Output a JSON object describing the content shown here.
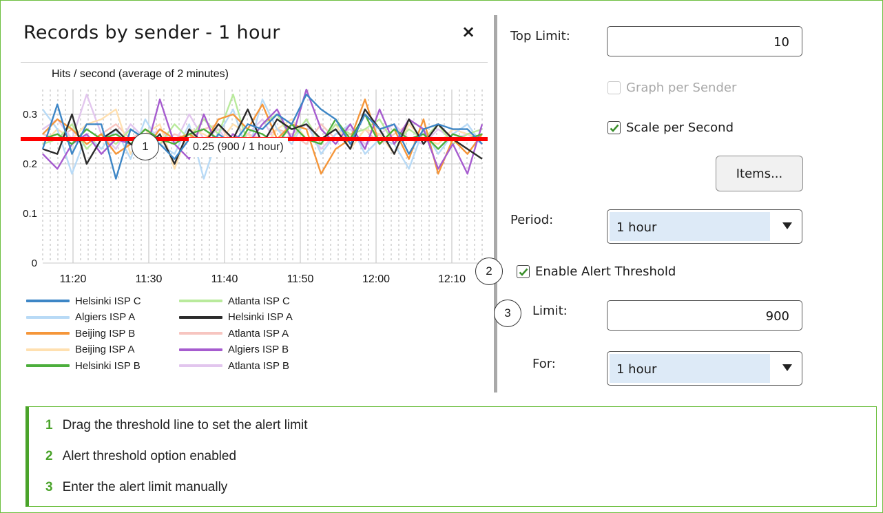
{
  "window": {
    "title": "Records by sender - 1 hour",
    "close_glyph": "×"
  },
  "chart_data": {
    "type": "line",
    "title": "Hits / second (average of 2 minutes)",
    "ylim": [
      0,
      0.35
    ],
    "y_ticks": [
      "0.3",
      "0.2",
      "0.1",
      "0"
    ],
    "x_ticks": [
      "11:20",
      "11:30",
      "11:40",
      "11:50",
      "12:00",
      "12:10"
    ],
    "x_tick_minutes": [
      20,
      30,
      40,
      50,
      60,
      70
    ],
    "x_range_minutes": [
      16,
      74
    ],
    "grid": true,
    "threshold": {
      "value": 0.25,
      "label": "0.25 (900 / 1 hour)",
      "color": "#ff0000"
    },
    "series": [
      {
        "name": "Helsinki ISP C",
        "color": "#3d86c6",
        "values": [
          0.23,
          0.32,
          0.22,
          0.28,
          0.28,
          0.17,
          0.27,
          0.25,
          0.24,
          0.21,
          0.25,
          0.22,
          0.26,
          0.24,
          0.28,
          0.27,
          0.3,
          0.28,
          0.34,
          0.31,
          0.29,
          0.24,
          0.3,
          0.27,
          0.28,
          0.22,
          0.27,
          0.28,
          0.27,
          0.27,
          0.24
        ]
      },
      {
        "name": "Algiers ISP A",
        "color": "#b8daf6",
        "values": [
          0.31,
          0.27,
          0.18,
          0.26,
          0.23,
          0.27,
          0.21,
          0.29,
          0.24,
          0.22,
          0.28,
          0.17,
          0.26,
          0.31,
          0.22,
          0.33,
          0.27,
          0.24,
          0.29,
          0.22,
          0.26,
          0.28,
          0.22,
          0.25,
          0.24,
          0.19,
          0.27,
          0.22,
          0.26,
          0.28,
          0.24
        ]
      },
      {
        "name": "Beijing ISP B",
        "color": "#f5963a",
        "values": [
          0.26,
          0.29,
          0.27,
          0.24,
          0.26,
          0.22,
          0.24,
          0.23,
          0.27,
          0.25,
          0.26,
          0.24,
          0.29,
          0.3,
          0.27,
          0.32,
          0.25,
          0.28,
          0.27,
          0.18,
          0.23,
          0.25,
          0.33,
          0.24,
          0.27,
          0.21,
          0.29,
          0.18,
          0.25,
          0.22,
          0.26
        ]
      },
      {
        "name": "Beijing ISP A",
        "color": "#ffe0b0",
        "values": [
          0.24,
          0.27,
          0.25,
          0.28,
          0.29,
          0.31,
          0.22,
          0.26,
          0.28,
          0.19,
          0.27,
          0.26,
          0.24,
          0.28,
          0.26,
          0.23,
          0.27,
          0.29,
          0.25,
          0.24,
          0.28,
          0.23,
          0.27,
          0.26,
          0.22,
          0.28,
          0.25,
          0.24,
          0.27,
          0.26,
          0.25
        ]
      },
      {
        "name": "Helsinki ISP B",
        "color": "#4cae3c",
        "values": [
          0.25,
          0.26,
          0.24,
          0.27,
          0.25,
          0.26,
          0.24,
          0.27,
          0.25,
          0.24,
          0.26,
          0.27,
          0.25,
          0.22,
          0.27,
          0.26,
          0.24,
          0.28,
          0.25,
          0.24,
          0.29,
          0.25,
          0.3,
          0.24,
          0.27,
          0.25,
          0.26,
          0.23,
          0.26,
          0.25,
          0.26
        ]
      },
      {
        "name": "Atlanta ISP C",
        "color": "#b9ea9c",
        "values": [
          0.24,
          0.25,
          0.28,
          0.23,
          0.26,
          0.24,
          0.27,
          0.25,
          0.24,
          0.28,
          0.25,
          0.29,
          0.26,
          0.34,
          0.24,
          0.28,
          0.3,
          0.25,
          0.29,
          0.24,
          0.28,
          0.26,
          0.27,
          0.29,
          0.24,
          0.27,
          0.25,
          0.28,
          0.24,
          0.26,
          0.27
        ]
      },
      {
        "name": "Helsinki ISP A",
        "color": "#2b2b2b",
        "values": [
          0.23,
          0.22,
          0.3,
          0.2,
          0.25,
          0.27,
          0.24,
          0.23,
          0.26,
          0.2,
          0.27,
          0.24,
          0.28,
          0.25,
          0.31,
          0.24,
          0.29,
          0.27,
          0.28,
          0.25,
          0.27,
          0.23,
          0.31,
          0.27,
          0.22,
          0.29,
          0.24,
          0.28,
          0.25,
          0.23,
          0.21
        ]
      },
      {
        "name": "Atlanta ISP A",
        "color": "#f7c5c0",
        "values": [
          0.26,
          0.25,
          0.27,
          0.24,
          0.26,
          0.28,
          0.25,
          0.27,
          0.24,
          0.26,
          0.25,
          0.27,
          0.28,
          0.24,
          0.26,
          0.25,
          0.27,
          0.26,
          0.24,
          0.28,
          0.25,
          0.26,
          0.27,
          0.24,
          0.26,
          0.28,
          0.25,
          0.24,
          0.27,
          0.26,
          0.25
        ]
      },
      {
        "name": "Algiers ISP B",
        "color": "#a65ccf",
        "values": [
          0.22,
          0.19,
          0.24,
          0.26,
          0.22,
          0.25,
          0.24,
          0.22,
          0.33,
          0.24,
          0.21,
          0.3,
          0.23,
          0.26,
          0.24,
          0.28,
          0.31,
          0.25,
          0.35,
          0.27,
          0.24,
          0.28,
          0.23,
          0.31,
          0.24,
          0.29,
          0.27,
          0.19,
          0.24,
          0.18,
          0.28
        ]
      },
      {
        "name": "Atlanta ISP B",
        "color": "#e2c6ee",
        "values": [
          0.27,
          0.29,
          0.25,
          0.34,
          0.26,
          0.23,
          0.28,
          0.25,
          0.27,
          0.24,
          0.3,
          0.25,
          0.27,
          0.23,
          0.26,
          0.29,
          0.24,
          0.26,
          0.28,
          0.23,
          0.26,
          0.27,
          0.24,
          0.26,
          0.28,
          0.25,
          0.24,
          0.27,
          0.25,
          0.26,
          0.24
        ]
      }
    ]
  },
  "callouts": {
    "one": "1",
    "two": "2",
    "three": "3"
  },
  "settings": {
    "top_limit_label": "Top Limit:",
    "top_limit_value": "10",
    "graph_per_sender_label": "Graph per Sender",
    "graph_per_sender_checked": false,
    "scale_per_second_label": "Scale per Second",
    "scale_per_second_checked": true,
    "items_button": "Items...",
    "period_label": "Period:",
    "period_value": "1 hour",
    "enable_alert_label": "Enable Alert Threshold",
    "enable_alert_checked": true,
    "limit_label": "Limit:",
    "limit_value": "900",
    "for_label": "For:",
    "for_value": "1 hour"
  },
  "notes": [
    {
      "num": "1",
      "text": "Drag the threshold line to set the alert limit"
    },
    {
      "num": "2",
      "text": "Alert threshold option enabled"
    },
    {
      "num": "3",
      "text": "Enter the alert limit manually"
    }
  ],
  "icons": {
    "close": "close-icon",
    "check": "checkmark-icon",
    "dropdown": "chevron-down-icon"
  }
}
